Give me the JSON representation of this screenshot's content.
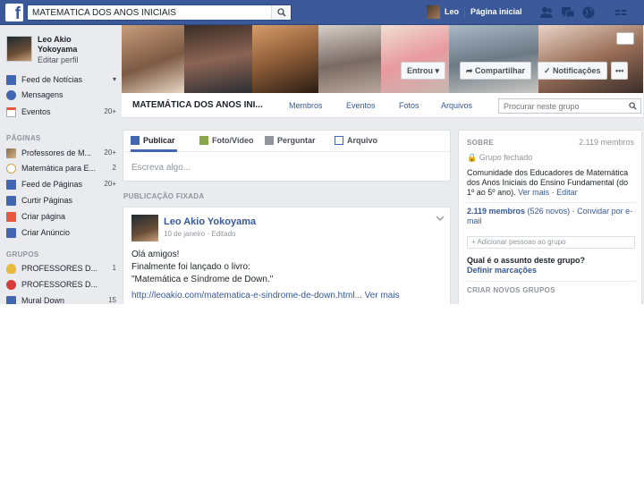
{
  "topbar": {
    "logo": "f",
    "search_value": "MATEMÁTICA DOS ANOS INICIAIS",
    "user_name": "Leo",
    "home_label": "Página inicial",
    "icons": [
      "friends-icon",
      "messages-icon",
      "globe-icon",
      "settings-icon"
    ]
  },
  "profile": {
    "name": "Leo Akio Yokoyama",
    "edit_label": "Editar perfil"
  },
  "nav": {
    "main": [
      {
        "label": "Feed de Notícias",
        "count": "",
        "icon": "news-feed-icon",
        "color": "#4267b2"
      },
      {
        "label": "Mensagens",
        "count": "",
        "icon": "messages-icon",
        "color": "#4267b2"
      },
      {
        "label": "Eventos",
        "count": "20+",
        "icon": "calendar-icon",
        "color": "#e9573f"
      }
    ],
    "pages_heading": "PÁGINAS",
    "pages": [
      {
        "label": "Professores de M...",
        "count": "20+",
        "icon": "page-thumb-icon",
        "color": "#8b6d4a"
      },
      {
        "label": "Matemática para E...",
        "count": "2",
        "icon": "page-logo-icon",
        "color": "#d9a13b"
      },
      {
        "label": "Feed de Páginas",
        "count": "20+",
        "icon": "pages-feed-icon",
        "color": "#4267b2"
      },
      {
        "label": "Curtir Páginas",
        "count": "",
        "icon": "like-pages-icon",
        "color": "#4267b2"
      },
      {
        "label": "Criar página",
        "count": "",
        "icon": "create-page-icon",
        "color": "#e9573f"
      },
      {
        "label": "Criar Anúncio",
        "count": "",
        "icon": "create-ad-icon",
        "color": "#4267b2"
      }
    ],
    "groups_heading": "GRUPOS",
    "groups": [
      {
        "label": "PROFESSORES D...",
        "count": "1",
        "icon": "lightbulb-icon",
        "color": "#e8b93b"
      },
      {
        "label": "PROFESSORES D...",
        "count": "",
        "icon": "apple-icon",
        "color": "#d93b3b"
      },
      {
        "label": "Mural Down",
        "count": "15",
        "icon": "group-icon",
        "color": "#4267b2"
      }
    ]
  },
  "cover": {
    "joined_label": "Entrou",
    "share_label": "Compartilhar",
    "notifications_label": "Notificações",
    "more_label": "•••"
  },
  "group": {
    "title": "MATEMÁTICA DOS ANOS INI...",
    "tabs": [
      "Membros",
      "Eventos",
      "Fotos",
      "Arquivos"
    ],
    "search_placeholder": "Procurar neste grupo"
  },
  "composer": {
    "tabs": [
      "Publicar",
      "Foto/Vídeo",
      "Perguntar",
      "Arquivo"
    ],
    "placeholder": "Escreva algo..."
  },
  "pinned": {
    "label": "PUBLICAÇÃO FIXADA",
    "author": "Leo Akio Yokoyama",
    "date": "10 de janeiro · Editado",
    "lines": [
      "Olá amigos!",
      "Finalmente foi lançado o livro:",
      "\"Matemática e Síndrome de Down.\""
    ],
    "link": "http://leoakio.com/matematica-e-sindrome-de-down.html...",
    "see_more": "Ver mais"
  },
  "about": {
    "heading": "SOBRE",
    "members_count": "2.119 membros",
    "privacy": "Grupo fechado",
    "description": "Comunidade dos Educadores de Matemática dos Anos Iniciais do Ensino Fundamental (do 1º ao 5º ano).",
    "see_more": "Ver mais",
    "edit": "Editar",
    "members_line": "2.119 membros",
    "new_members": "(526 novos)",
    "invite": "Convidar por e-mail",
    "add_people": "+ Adicionar pessoas ao grupo",
    "question": "Qual é o assunto deste grupo?",
    "tags_link": "Definir marcações",
    "create_heading": "CRIAR NOVOS GRUPOS"
  },
  "colors": {
    "brand": "#3b5998",
    "link": "#365899",
    "background": "#e9ebee"
  }
}
